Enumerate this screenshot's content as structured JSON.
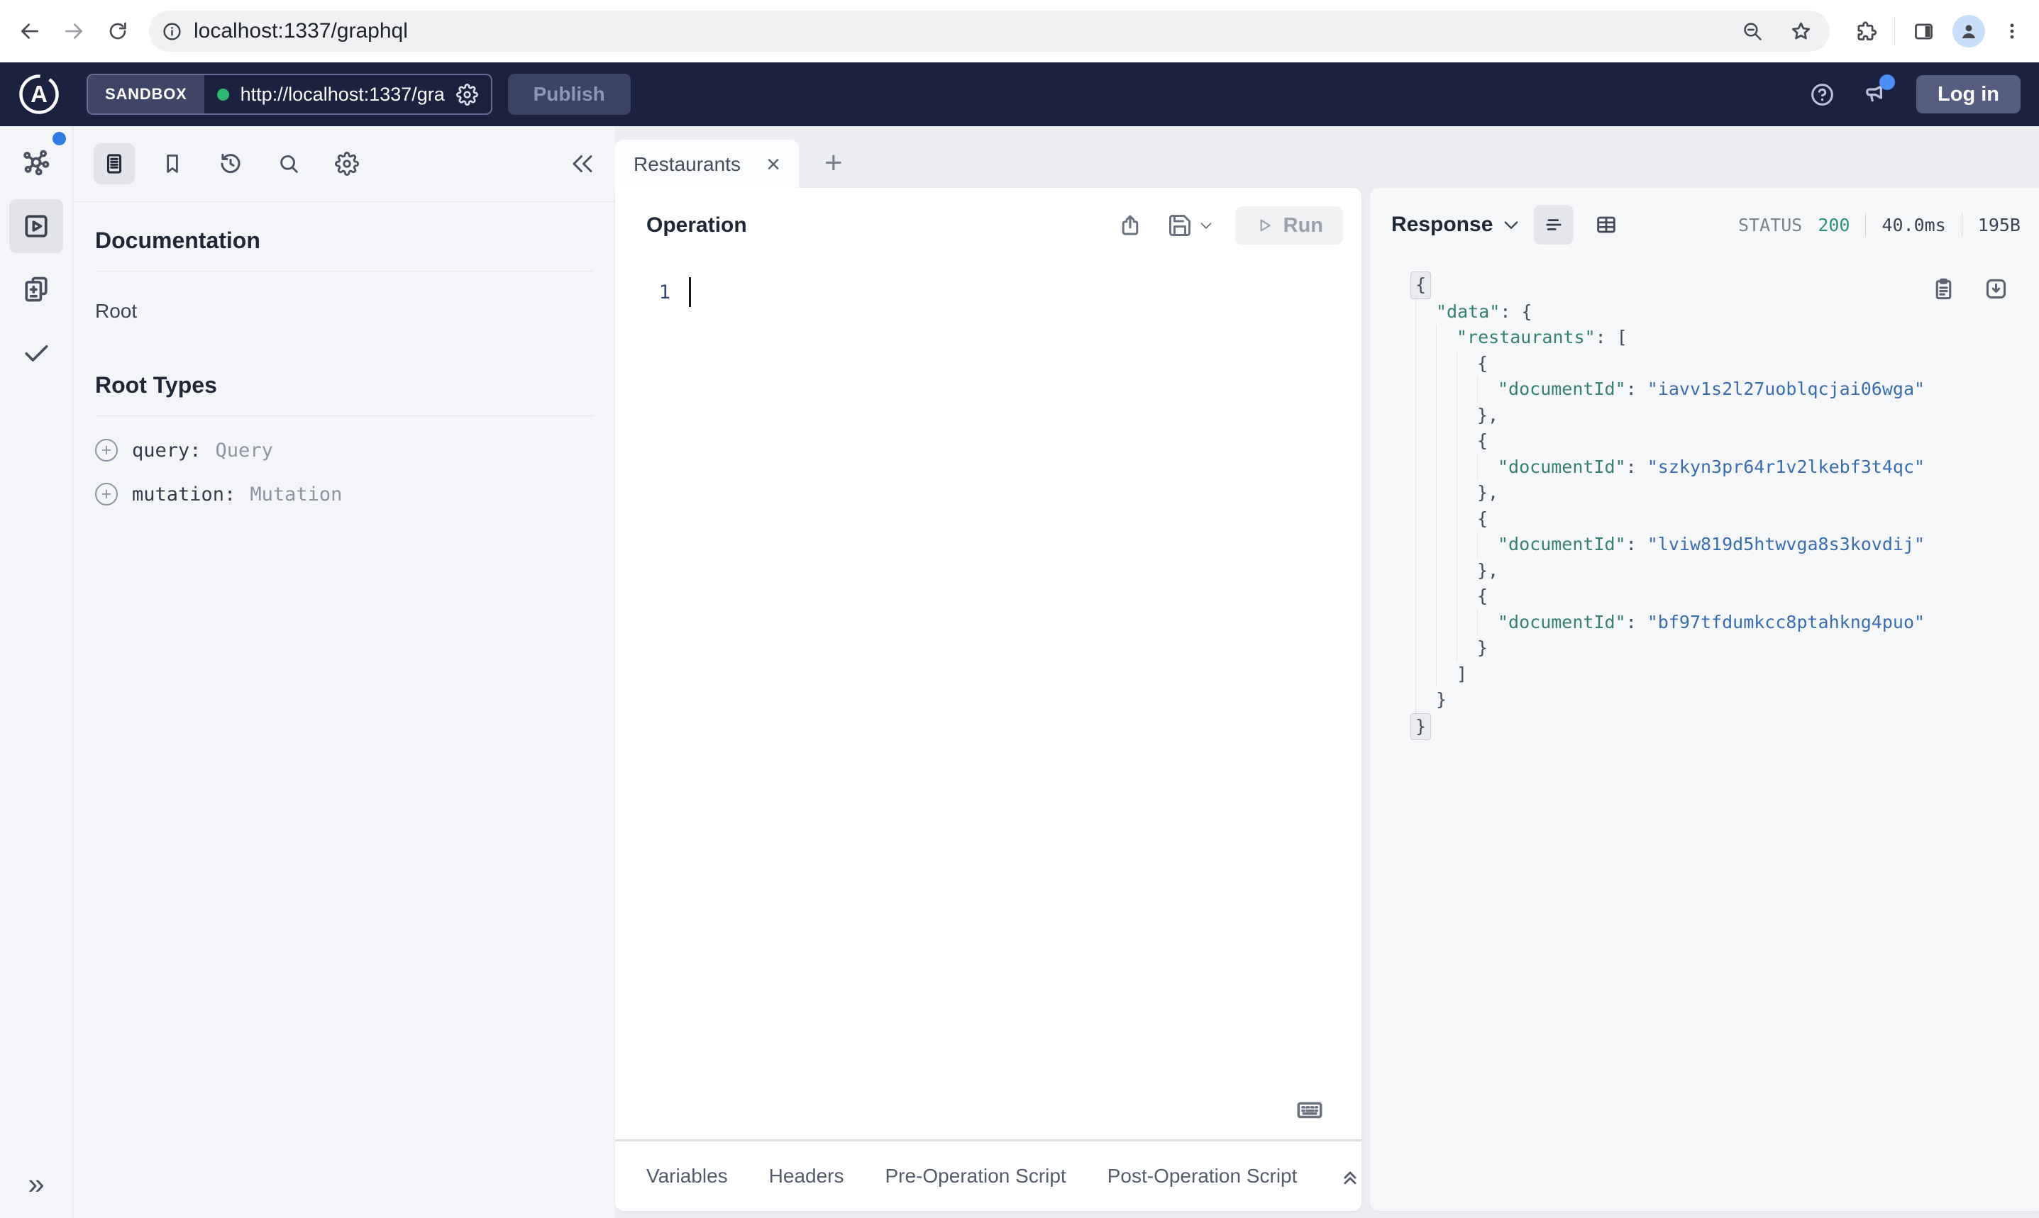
{
  "browser": {
    "url": "localhost:1337/graphql"
  },
  "header": {
    "env_label": "SANDBOX",
    "logo_letter": "A",
    "endpoint": "http://localhost:1337/gra...",
    "publish_label": "Publish",
    "login_label": "Log in"
  },
  "doc_panel": {
    "title": "Documentation",
    "root_link": "Root",
    "section_title": "Root Types",
    "types": [
      {
        "field": "query:",
        "type": "Query"
      },
      {
        "field": "mutation:",
        "type": "Mutation"
      }
    ]
  },
  "tabs": {
    "active_label": "Restaurants"
  },
  "operation": {
    "title": "Operation",
    "run_label": "Run",
    "line_number": "1"
  },
  "response": {
    "title": "Response",
    "status_label": "STATUS",
    "status_code": "200",
    "time": "40.0ms",
    "size": "195B",
    "json_lines": [
      {
        "i": 0,
        "fold": true,
        "seg": [
          [
            "p",
            "{"
          ]
        ]
      },
      {
        "i": 1,
        "seg": [
          [
            "k",
            "\"data\""
          ],
          [
            "p",
            ": {"
          ]
        ]
      },
      {
        "i": 2,
        "seg": [
          [
            "k",
            "\"restaurants\""
          ],
          [
            "p",
            ": ["
          ]
        ]
      },
      {
        "i": 3,
        "seg": [
          [
            "p",
            "{"
          ]
        ]
      },
      {
        "i": 4,
        "seg": [
          [
            "k",
            "\"documentId\""
          ],
          [
            "p",
            ": "
          ],
          [
            "s",
            "\"iavv1s2l27uoblqcjai06wga\""
          ]
        ]
      },
      {
        "i": 3,
        "seg": [
          [
            "p",
            "},"
          ]
        ]
      },
      {
        "i": 3,
        "seg": [
          [
            "p",
            "{"
          ]
        ]
      },
      {
        "i": 4,
        "seg": [
          [
            "k",
            "\"documentId\""
          ],
          [
            "p",
            ": "
          ],
          [
            "s",
            "\"szkyn3pr64r1v2lkebf3t4qc\""
          ]
        ]
      },
      {
        "i": 3,
        "seg": [
          [
            "p",
            "},"
          ]
        ]
      },
      {
        "i": 3,
        "seg": [
          [
            "p",
            "{"
          ]
        ]
      },
      {
        "i": 4,
        "seg": [
          [
            "k",
            "\"documentId\""
          ],
          [
            "p",
            ": "
          ],
          [
            "s",
            "\"lviw819d5htwvga8s3kovdij\""
          ]
        ]
      },
      {
        "i": 3,
        "seg": [
          [
            "p",
            "},"
          ]
        ]
      },
      {
        "i": 3,
        "seg": [
          [
            "p",
            "{"
          ]
        ]
      },
      {
        "i": 4,
        "seg": [
          [
            "k",
            "\"documentId\""
          ],
          [
            "p",
            ": "
          ],
          [
            "s",
            "\"bf97tfdumkcc8ptahkng4puo\""
          ]
        ]
      },
      {
        "i": 3,
        "seg": [
          [
            "p",
            "}"
          ]
        ]
      },
      {
        "i": 2,
        "seg": [
          [
            "p",
            "]"
          ]
        ]
      },
      {
        "i": 1,
        "seg": [
          [
            "p",
            "}"
          ]
        ]
      },
      {
        "i": 0,
        "fold": true,
        "seg": [
          [
            "p",
            "}"
          ]
        ]
      }
    ]
  },
  "bottom_tabs": [
    "Variables",
    "Headers",
    "Pre-Operation Script",
    "Post-Operation Script"
  ],
  "glyphs": {
    "close": "×",
    "new_tab": "+",
    "expand_right": "»",
    "plus": "+"
  },
  "colors": {
    "header_bg": "#1b2240",
    "status_ok": "#2a9479",
    "json_key": "#35806f",
    "json_string": "#3a6cb0",
    "notification_blue": "#2f7de1",
    "endpoint_dot_green": "#2eb873",
    "login_button_bg": "#555e80"
  }
}
